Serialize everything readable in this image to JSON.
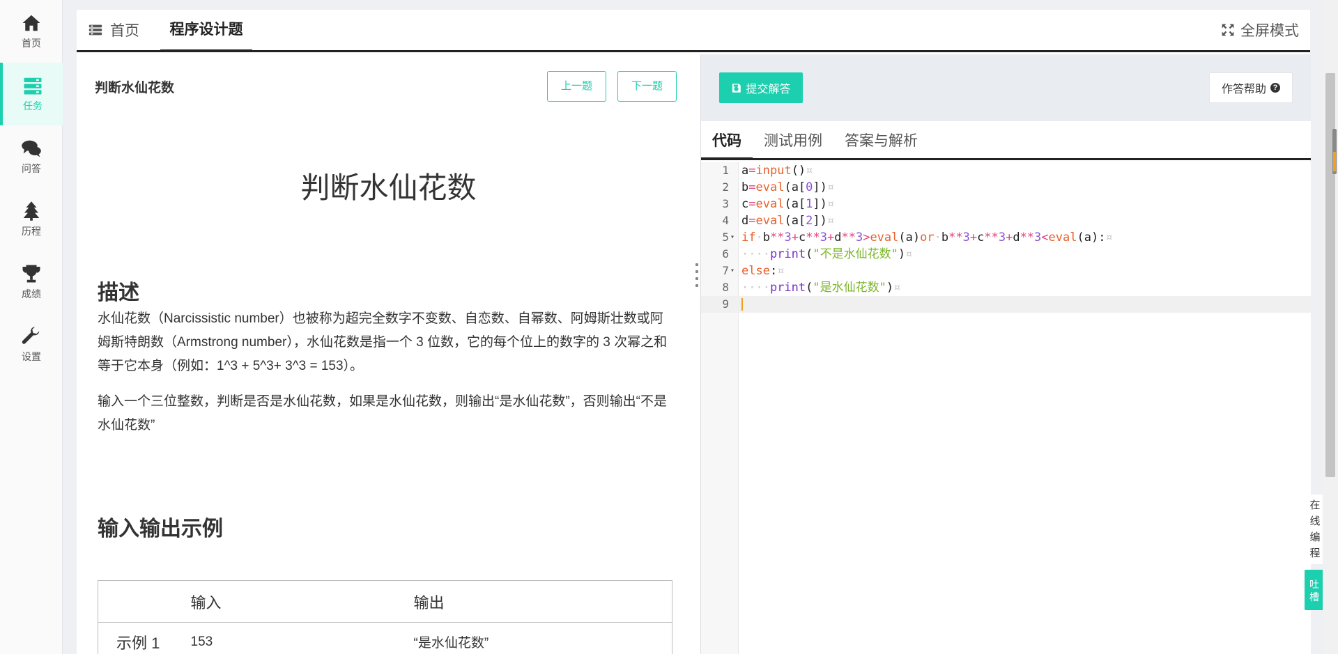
{
  "sidebar": {
    "items": [
      {
        "label": "首页",
        "icon": "home-icon"
      },
      {
        "label": "任务",
        "icon": "tasks-icon",
        "active": true
      },
      {
        "label": "问答",
        "icon": "comments-icon"
      },
      {
        "label": "历程",
        "icon": "tree-icon"
      },
      {
        "label": "成绩",
        "icon": "trophy-icon"
      },
      {
        "label": "设置",
        "icon": "wrench-icon"
      }
    ]
  },
  "header": {
    "home_tab": "首页",
    "current_tab": "程序设计题",
    "fullscreen": "全屏模式"
  },
  "problem": {
    "small_title": "判断水仙花数",
    "prev_label": "上一题",
    "next_label": "下一题",
    "title": "判断水仙花数",
    "description_heading": "描述",
    "paragraph1": "水仙花数（Narcissistic number）也被称为超完全数字不变数、自恋数、自幂数、阿姆斯壮数或阿姆斯特朗数（Armstrong number），水仙花数是指一个 3 位数，它的每个位上的数字的 3 次幂之和等于它本身（例如：1^3 + 5^3+ 3^3 = 153）。",
    "paragraph2": "输入一个三位整数，判断是否是水仙花数，如果是水仙花数，则输出“是水仙花数”，否则输出“不是水仙花数”",
    "io_heading": "输入输出示例",
    "io_table": {
      "headers": [
        "",
        "输入",
        "输出"
      ],
      "rows": [
        {
          "label": "示例 1",
          "input": "153",
          "output": "“是水仙花数”"
        }
      ]
    }
  },
  "editor": {
    "submit_label": "提交解答",
    "help_label": "作答帮助",
    "tabs": [
      "代码",
      "测试用例",
      "答案与解析"
    ],
    "line_numbers": [
      "1",
      "2",
      "3",
      "4",
      "5",
      "6",
      "7",
      "8",
      "9"
    ]
  },
  "floating": {
    "online_chars": [
      "在",
      "线",
      "编",
      "程"
    ],
    "feedback_chars": [
      "吐",
      "槽"
    ]
  },
  "colors": {
    "accent": "#1ccfae",
    "keyword": "#e8602c",
    "operator": "#e5427a",
    "number": "#8a52d6",
    "string": "#7bb52a"
  }
}
